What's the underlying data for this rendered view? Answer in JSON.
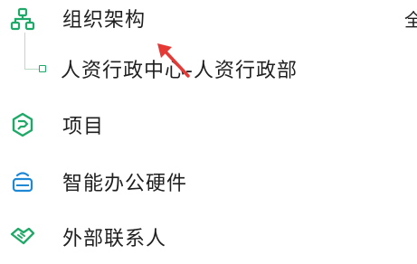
{
  "menu": {
    "org_structure": {
      "label": "组织架构",
      "icon": "org-chart-icon"
    },
    "department": {
      "label": "人资行政中心-人资行政部",
      "icon": "tree-node-icon"
    },
    "projects": {
      "label": "项目",
      "icon": "project-icon"
    },
    "smart_office_hardware": {
      "label": "智能办公硬件",
      "icon": "device-icon"
    },
    "external_contacts": {
      "label": "外部联系人",
      "icon": "handshake-icon"
    }
  },
  "edge_text": "全",
  "colors": {
    "accent": "#1fa968",
    "office_icon": "#1e88d6",
    "cursor": "#e53935"
  }
}
